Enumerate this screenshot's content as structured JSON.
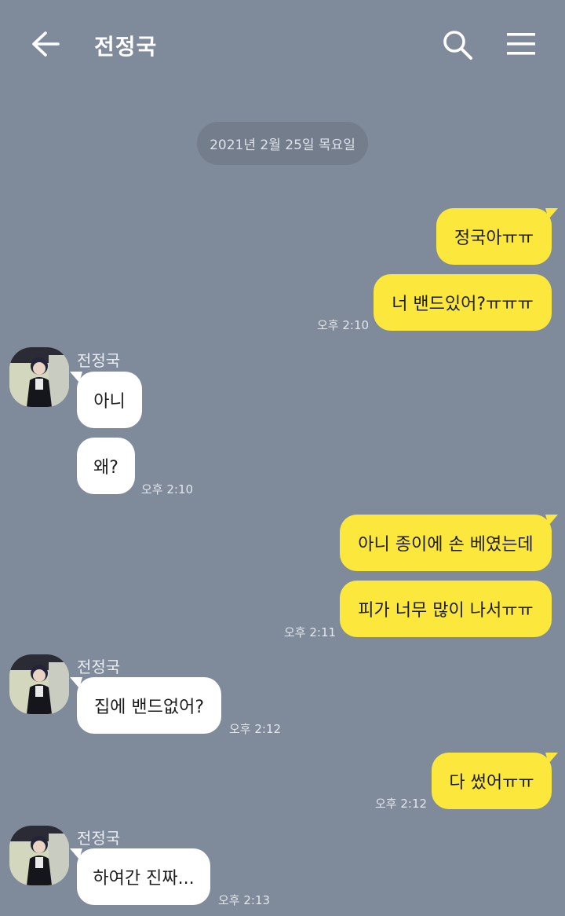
{
  "header": {
    "title": "전정국",
    "back_icon": "arrow-left-icon",
    "search_icon": "search-icon",
    "menu_icon": "hamburger-menu-icon"
  },
  "date_divider": "2021년 2월 25일 목요일",
  "colors": {
    "background": "#7f8a9a",
    "my_bubble": "#fce83c",
    "their_bubble": "#ffffff"
  },
  "messages": [
    {
      "sender": "me",
      "text": "정국아ㅠㅠ"
    },
    {
      "sender": "me",
      "text": "너 밴드있어?ㅠㅠㅠ",
      "time": "오후 2:10"
    },
    {
      "sender": "them",
      "name": "전정국",
      "text": "아니"
    },
    {
      "sender": "them",
      "text": "왜?",
      "time": "오후 2:10"
    },
    {
      "sender": "me",
      "text": "아니 종이에 손 베였는데"
    },
    {
      "sender": "me",
      "text": "피가 너무 많이 나서ㅠㅠ",
      "time": "오후 2:11"
    },
    {
      "sender": "them",
      "name": "전정국",
      "text": "집에 밴드없어?",
      "time": "오후 2:12"
    },
    {
      "sender": "me",
      "text": "다 썼어ㅠㅠ",
      "time": "오후 2:12"
    },
    {
      "sender": "them",
      "name": "전정국",
      "text": "하여간 진짜...",
      "time": "오후 2:13"
    }
  ]
}
